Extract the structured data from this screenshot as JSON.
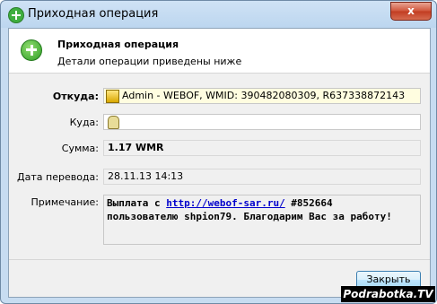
{
  "window": {
    "title": "Приходная операция",
    "close_label": "x"
  },
  "header": {
    "title": "Приходная операция",
    "subtitle": "Детали операции приведены ниже"
  },
  "fields": {
    "from_label": "Откуда:",
    "from_value": "Admin - WEBOF, WMID: 390482080309, R637338872143",
    "to_label": "Куда:",
    "to_value": "",
    "amount_label": "Сумма:",
    "amount_value": "1.17 WMR",
    "date_label": "Дата перевода:",
    "date_value": "28.11.13 14:13",
    "note_label": "Примечание:",
    "note_prefix": "Выплата с ",
    "note_link": "http://webof-sar.ru/",
    "note_rest1": " #852664",
    "note_rest2": "пользователю shpion79. Благодарим Вас за работу!"
  },
  "buttons": {
    "close": "Закрыть"
  },
  "watermark": "Podrabotka.TV"
}
